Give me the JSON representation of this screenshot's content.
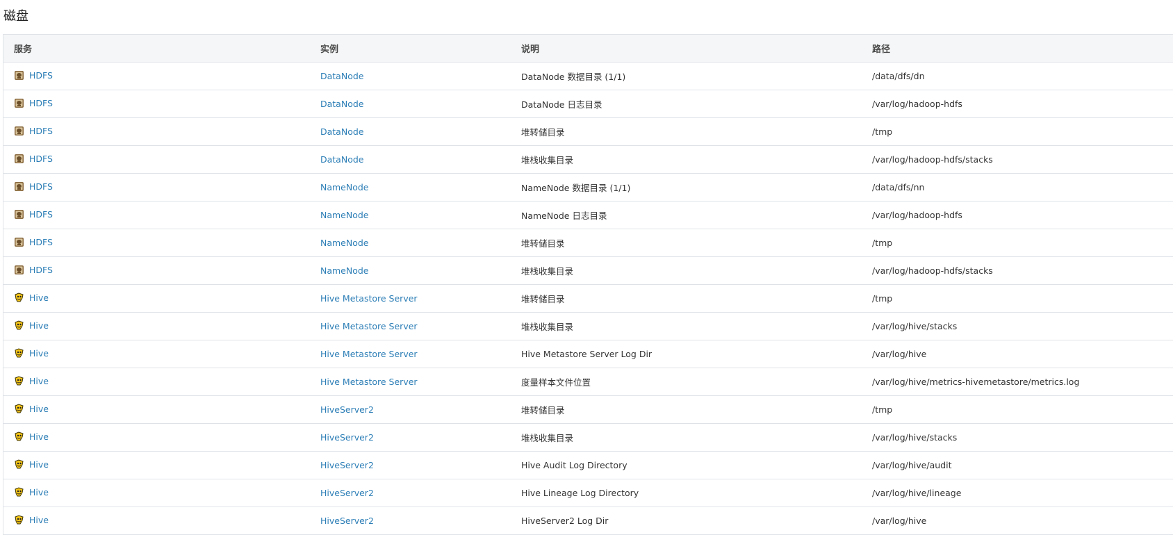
{
  "page": {
    "title": "磁盘"
  },
  "table": {
    "headers": [
      "服务",
      "实例",
      "说明",
      "路径"
    ],
    "rows": [
      {
        "service": "HDFS",
        "service_icon": "hdfs-icon",
        "instance": "DataNode",
        "description": "DataNode 数据目录 (1/1)",
        "path": "/data/dfs/dn"
      },
      {
        "service": "HDFS",
        "service_icon": "hdfs-icon",
        "instance": "DataNode",
        "description": "DataNode 日志目录",
        "path": "/var/log/hadoop-hdfs"
      },
      {
        "service": "HDFS",
        "service_icon": "hdfs-icon",
        "instance": "DataNode",
        "description": "堆转储目录",
        "path": "/tmp"
      },
      {
        "service": "HDFS",
        "service_icon": "hdfs-icon",
        "instance": "DataNode",
        "description": "堆栈收集目录",
        "path": "/var/log/hadoop-hdfs/stacks"
      },
      {
        "service": "HDFS",
        "service_icon": "hdfs-icon",
        "instance": "NameNode",
        "description": "NameNode 数据目录 (1/1)",
        "path": "/data/dfs/nn"
      },
      {
        "service": "HDFS",
        "service_icon": "hdfs-icon",
        "instance": "NameNode",
        "description": "NameNode 日志目录",
        "path": "/var/log/hadoop-hdfs"
      },
      {
        "service": "HDFS",
        "service_icon": "hdfs-icon",
        "instance": "NameNode",
        "description": "堆转储目录",
        "path": "/tmp"
      },
      {
        "service": "HDFS",
        "service_icon": "hdfs-icon",
        "instance": "NameNode",
        "description": "堆栈收集目录",
        "path": "/var/log/hadoop-hdfs/stacks"
      },
      {
        "service": "Hive",
        "service_icon": "hive-icon",
        "instance": "Hive Metastore Server",
        "description": "堆转储目录",
        "path": "/tmp"
      },
      {
        "service": "Hive",
        "service_icon": "hive-icon",
        "instance": "Hive Metastore Server",
        "description": "堆栈收集目录",
        "path": "/var/log/hive/stacks"
      },
      {
        "service": "Hive",
        "service_icon": "hive-icon",
        "instance": "Hive Metastore Server",
        "description": "Hive Metastore Server Log Dir",
        "path": "/var/log/hive"
      },
      {
        "service": "Hive",
        "service_icon": "hive-icon",
        "instance": "Hive Metastore Server",
        "description": "度量样本文件位置",
        "path": "/var/log/hive/metrics-hivemetastore/metrics.log"
      },
      {
        "service": "Hive",
        "service_icon": "hive-icon",
        "instance": "HiveServer2",
        "description": "堆转储目录",
        "path": "/tmp"
      },
      {
        "service": "Hive",
        "service_icon": "hive-icon",
        "instance": "HiveServer2",
        "description": "堆栈收集目录",
        "path": "/var/log/hive/stacks"
      },
      {
        "service": "Hive",
        "service_icon": "hive-icon",
        "instance": "HiveServer2",
        "description": "Hive Audit Log Directory",
        "path": "/var/log/hive/audit"
      },
      {
        "service": "Hive",
        "service_icon": "hive-icon",
        "instance": "HiveServer2",
        "description": "Hive Lineage Log Directory",
        "path": "/var/log/hive/lineage"
      },
      {
        "service": "Hive",
        "service_icon": "hive-icon",
        "instance": "HiveServer2",
        "description": "HiveServer2 Log Dir",
        "path": "/var/log/hive"
      }
    ]
  },
  "colors": {
    "link": "#2c7eb6",
    "header_bg": "#f5f6f7",
    "border": "#dfe3e8"
  }
}
